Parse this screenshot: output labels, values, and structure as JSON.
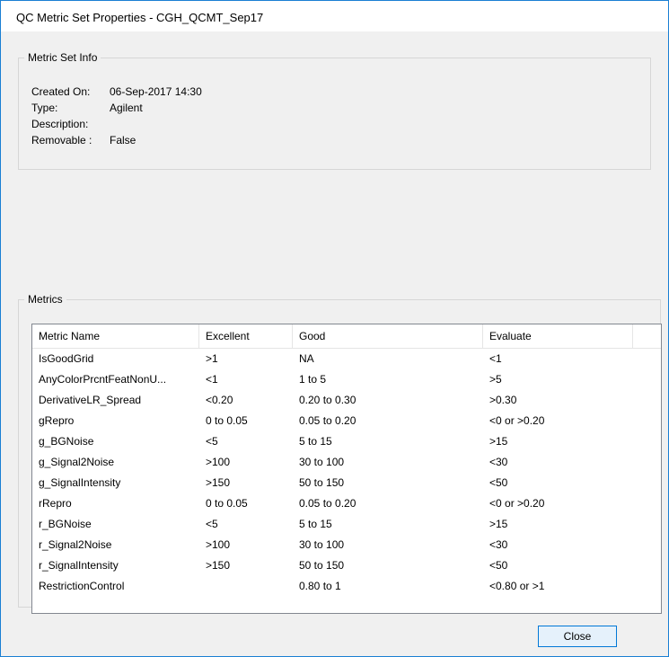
{
  "window": {
    "title": "QC Metric Set Properties - CGH_QCMT_Sep17"
  },
  "metric_set_info": {
    "legend": "Metric Set Info",
    "fields": [
      {
        "label": "Created On:",
        "value": "06-Sep-2017 14:30"
      },
      {
        "label": "Type:",
        "value": "Agilent"
      },
      {
        "label": "Description:",
        "value": ""
      },
      {
        "label": "Removable :",
        "value": "False"
      }
    ]
  },
  "metrics": {
    "legend": "Metrics",
    "columns": [
      "Metric Name",
      "Excellent",
      "Good",
      "Evaluate"
    ],
    "rows": [
      [
        "IsGoodGrid",
        ">1",
        "NA",
        "<1"
      ],
      [
        "AnyColorPrcntFeatNonU...",
        "<1",
        "1 to 5",
        ">5"
      ],
      [
        "DerivativeLR_Spread",
        "<0.20",
        "0.20 to 0.30",
        ">0.30"
      ],
      [
        "gRepro",
        "0 to 0.05",
        "0.05 to 0.20",
        "<0 or >0.20"
      ],
      [
        "g_BGNoise",
        "<5",
        "5 to 15",
        ">15"
      ],
      [
        "g_Signal2Noise",
        ">100",
        "30 to 100",
        "<30"
      ],
      [
        "g_SignalIntensity",
        ">150",
        "50 to 150",
        "<50"
      ],
      [
        "rRepro",
        "0 to 0.05",
        "0.05 to 0.20",
        "<0 or >0.20"
      ],
      [
        "r_BGNoise",
        "<5",
        "5 to 15",
        ">15"
      ],
      [
        "r_Signal2Noise",
        ">100",
        "30 to 100",
        "<30"
      ],
      [
        "r_SignalIntensity",
        ">150",
        "50 to 150",
        "<50"
      ],
      [
        "RestrictionControl",
        "",
        "0.80 to 1",
        "<0.80 or >1"
      ]
    ]
  },
  "buttons": {
    "close": "Close"
  }
}
